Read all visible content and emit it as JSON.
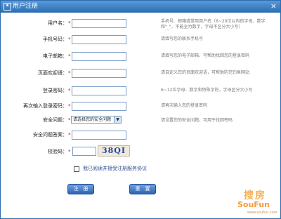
{
  "window": {
    "title": "用户注册",
    "close_label": "×"
  },
  "fields": [
    {
      "label": "用户名：",
      "required": "*",
      "hint": "手机号、邮箱或常用用户名（6~20位以内的字母、数字和\"_\"，不能全为数字，字母不区分大小写）"
    },
    {
      "label": "手机号码：",
      "required": "*",
      "hint": "请填写您的联系手机号"
    },
    {
      "label": "电子邮箱：",
      "required": "*",
      "hint": "请填写您的电子邮箱，可帮助找回您的登录密码"
    },
    {
      "label": "页面欢迎语：",
      "required": "*",
      "hint": "请自定义您的页面欢迎语，可帮助防范钓鱼网站"
    },
    {
      "label": "登录密码：",
      "required": "*",
      "hint": "6~12位字母、数字和特殊字符，字母区分大小写"
    },
    {
      "label": "再次输入登录密码：",
      "required": "*",
      "hint": "请再次输入您的登录密码"
    },
    {
      "label": "安全问题：",
      "required": "*",
      "hint": "请设置您的安全问题，可用于找回密码"
    },
    {
      "label": "安全问题答案：",
      "required": "*",
      "hint": ""
    },
    {
      "label": "校验码：",
      "required": "*",
      "hint": ""
    }
  ],
  "security_question": {
    "selected": "请选择您的安全问题",
    "arrow": "▼"
  },
  "captcha": {
    "text": "38QI"
  },
  "agreement": {
    "text": "我已阅读并接受注册服务协议"
  },
  "buttons": {
    "register": "注　册",
    "reset": "重　置"
  },
  "watermark": {
    "cn": "搜房",
    "en": "SouFun",
    "url": "www.soufun.com"
  }
}
